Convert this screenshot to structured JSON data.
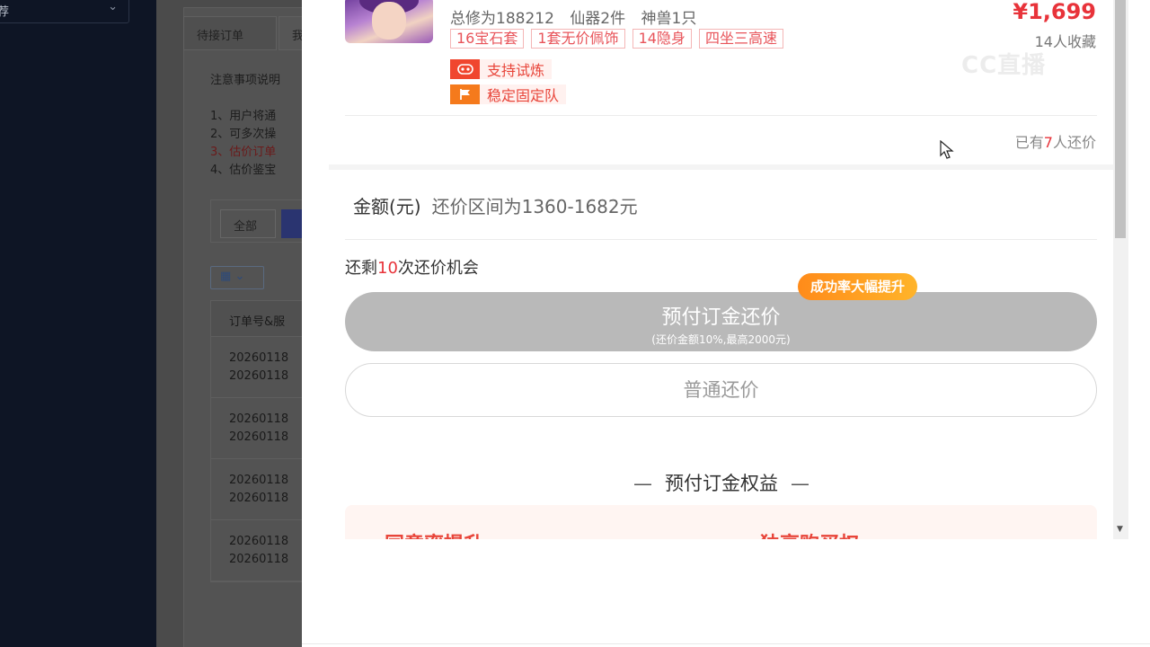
{
  "background": {
    "sidebar_select": "荐",
    "tabs": [
      "待接订单",
      "我"
    ],
    "notes_title": "注意事项说明",
    "notes": [
      "1、用户将通",
      "2、可多次操",
      "3、估价订单",
      "4、估价鉴宝"
    ],
    "filter_all": "全部",
    "table_header": "订单号&服",
    "rows": [
      [
        "20260118",
        "20260118"
      ],
      [
        "20260118",
        "20260118"
      ],
      [
        "20260118",
        "20260118"
      ],
      [
        "20260118",
        "20260118"
      ]
    ]
  },
  "item": {
    "stats": [
      "总修为188212",
      "仙器2件",
      "神兽1只"
    ],
    "price": "¥1,699",
    "favorites": "14人收藏",
    "tags": [
      "16宝石套",
      "1套无价佩饰",
      "14隐身",
      "四坐三高速"
    ],
    "badges": [
      {
        "icon": "trial-icon",
        "label": "支持试炼"
      },
      {
        "icon": "flag-icon",
        "label": "稳定固定队"
      }
    ]
  },
  "bargain": {
    "count_prefix": "已有",
    "count": "7",
    "count_suffix": "人还价",
    "amount_label": "金额(元)",
    "range_text": "还价区间为1360-1682元",
    "remaining_prefix": "还剩",
    "remaining_count": "10",
    "remaining_suffix": "次还价机会",
    "promo_badge": "成功率大幅提升",
    "deposit_button": "预付订金还价",
    "deposit_note": "(还价金额10%,最高2000元)",
    "normal_button": "普通还价",
    "benefits_title": "预付订金权益",
    "benefit_1": "同意率提升",
    "benefit_2": "独享购买权"
  },
  "watermark": "CC直播"
}
